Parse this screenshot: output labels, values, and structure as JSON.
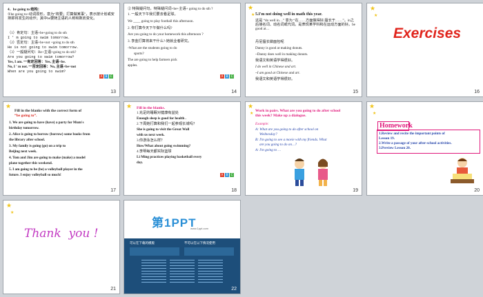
{
  "slides": [
    {
      "number": "13",
      "lines": [
        "4．be going to 结构：",
        "①be going to+动词原形，意为“将要；打算做某事”，表示按计划或安排即将发生的动作；其中be要随主语的人称和数而变化。",
        "（1）肯定句：主语+be+going to do sth",
        "I ' m going to swim tomorrow.",
        "（2）否定句：主语+be+not +going to do sth",
        "He is not going to swim tomorrow.",
        "（3）一般疑问句：Be+主语+going to do sth?",
        "Are you going to swim tomorrow?",
        "Yes, I am. 一肯定回答：Yes, 主语+be.",
        "No, I ' m not. 一否定回答：No, 主语+be+not",
        "When are you going to swim?"
      ]
    },
    {
      "number": "14",
      "lines": [
        "② 特殊疑问句，特殊疑问词+be+主语+ going to do sth ?",
        "1. 一般天下午我们要去看足球。",
        "We ____ going to play football this afternoon.",
        "2. 你打算今天下午做什么吗?",
        "Are you going to do your homework this afternoon ?",
        "3. 李金打算将来干什么?-她就业者研究。",
        "-What are the students going to do",
        "sports?",
        "The are going to help farmers pick",
        "apples."
      ],
      "answers": [
        "are",
        "going",
        "to",
        "play",
        "football",
        "this afternoon",
        "are",
        "going to",
        "do",
        "sports",
        "are",
        "going",
        "to",
        "help",
        "pick"
      ]
    },
    {
      "number": "15",
      "lines": [
        "5.I'm not doing well in math this year.",
        "这是 “do well in…” 意为 “在……方面做得好;擅长于……”。in之后接名词、动名词或代词。是表现某学科和在运动方面的好。be good at…",
        "丹尼擅长做面包呢",
        "Danny is good at making donuts.",
        "~Danny does well in making donuts.",
        "我语文和英语学得很好。",
        "I do well in Chinese and art.",
        "~I am good at Chinese and art.",
        "我语文和英语学得很好。"
      ],
      "answers": [
        "does well in",
        "am good at"
      ]
    },
    {
      "number": "16",
      "title": "Exercises"
    },
    {
      "number": "17",
      "lines": [
        "Fill in the blanks with the correct form of",
        "“be going to”.",
        "1. We are going to have (have) a party for Mum's",
        "birthday tomorrow.",
        "2. Alice is going to borrow (borrow) some books from",
        "the library after school.",
        "3. My family is going (go) on a trip to",
        "Beijing next week.",
        "4. Tom and Jim are going to make (make) a model",
        "plane together this weekend.",
        "5. I am going to be (be) a volleyball player in the",
        "future. I enjoy volleyball so much!"
      ],
      "answers": [
        "are going to have",
        "is going to borrow",
        "is going",
        "are going to make",
        "am going to be"
      ]
    },
    {
      "number": "18",
      "lines": [
        "Fill in the blanks.",
        "1.充足的睡眠对健康有益处",
        "Enough sleep is good for health .",
        "2.下周她打算和我们一起参观长城吗？",
        "She is going to visit the Great Wall",
        "with us next week.",
        "3.你游泳怎么样？",
        "How/What about going swimming?",
        "4.李明每天都实际篮球",
        "Li Ming practices playing basketball every",
        "day."
      ],
      "answers": [
        "is good for",
        "is going to visit",
        "How/What",
        "about",
        "practices playing basketball"
      ]
    },
    {
      "number": "19",
      "lines": [
        "Work in pairs. What are you going to do after school",
        "this week? Make up a dialogue.",
        "Example:",
        "A: What are you going to do after school on",
        "Wednesday?",
        "B: I'm going to see a movie with my friends. What",
        "are you going to do on…?",
        "A: I'm going to …"
      ]
    },
    {
      "number": "20",
      "title": "Homework",
      "lines": [
        "1.Review and recite the important points of",
        "Lesson 19.",
        "2.Write a passage of your after-school activities.",
        "3.Preview Lesson 20."
      ]
    },
    {
      "number": "21",
      "title": "Thank  you !"
    },
    {
      "number": "22",
      "brand": "第1PPT",
      "url": "www.1ppt.com",
      "col1": "可以在下载的模版",
      "col2": "不可以在以下情况使用"
    }
  ],
  "abc_colors": [
    "#e0412b",
    "#3a9ad9",
    "#4bb24b"
  ],
  "colors": {
    "accent_red": "#d9251d",
    "accent_blue": "#1f3fa8",
    "homework_pink": "#e0167a",
    "thankyou_purple": "#b62bb5"
  }
}
